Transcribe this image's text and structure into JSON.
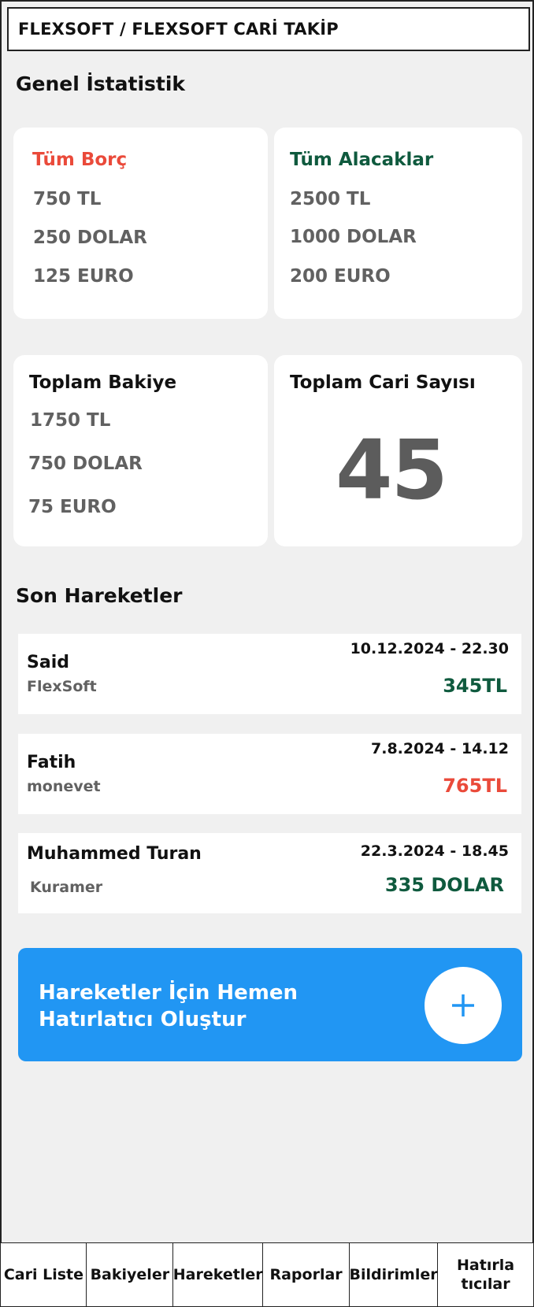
{
  "header": {
    "title": "FLEXSOFT / FLEXSOFT CARİ TAKİP"
  },
  "stats": {
    "section_title": "Genel İstatistik",
    "debts": {
      "title": "Tüm Borç",
      "lines": [
        "750 TL",
        "250 DOLAR",
        "125 EURO"
      ]
    },
    "receivables": {
      "title": "Tüm Alacaklar",
      "lines": [
        "2500 TL",
        "1000 DOLAR",
        "200 EURO"
      ]
    },
    "balance": {
      "title": "Toplam Bakiye",
      "lines": [
        "1750 TL",
        "750 DOLAR",
        "75 EURO"
      ]
    },
    "accounts": {
      "title": "Toplam Cari Sayısı",
      "value": "45"
    }
  },
  "recent": {
    "section_title": "Son Hareketler",
    "items": [
      {
        "name": "Said",
        "company": "FlexSoft",
        "date": "10.12.2024 - 22.30",
        "amount": "345TL",
        "amount_color": "#0f5a3e"
      },
      {
        "name": "Fatih",
        "company": "monevet",
        "date": "7.8.2024 - 14.12",
        "amount": "765TL",
        "amount_color": "#ea4a3a"
      },
      {
        "name": "Muhammed Turan",
        "company": "Kuramer",
        "date": "22.3.2024 - 18.45",
        "amount": "335 DOLAR",
        "amount_color": "#0f5a3e"
      }
    ]
  },
  "reminder": {
    "text": "Hareketler İçin Hemen Hatırlatıcı Oluştur",
    "button_icon": "plus-icon",
    "accent_color": "#2196f3"
  },
  "bottom_nav": {
    "items": [
      "Cari Liste",
      "Bakiyeler",
      "Hareketler",
      "Raporlar",
      "Bildirimler",
      "Hatırla tıcılar"
    ]
  }
}
